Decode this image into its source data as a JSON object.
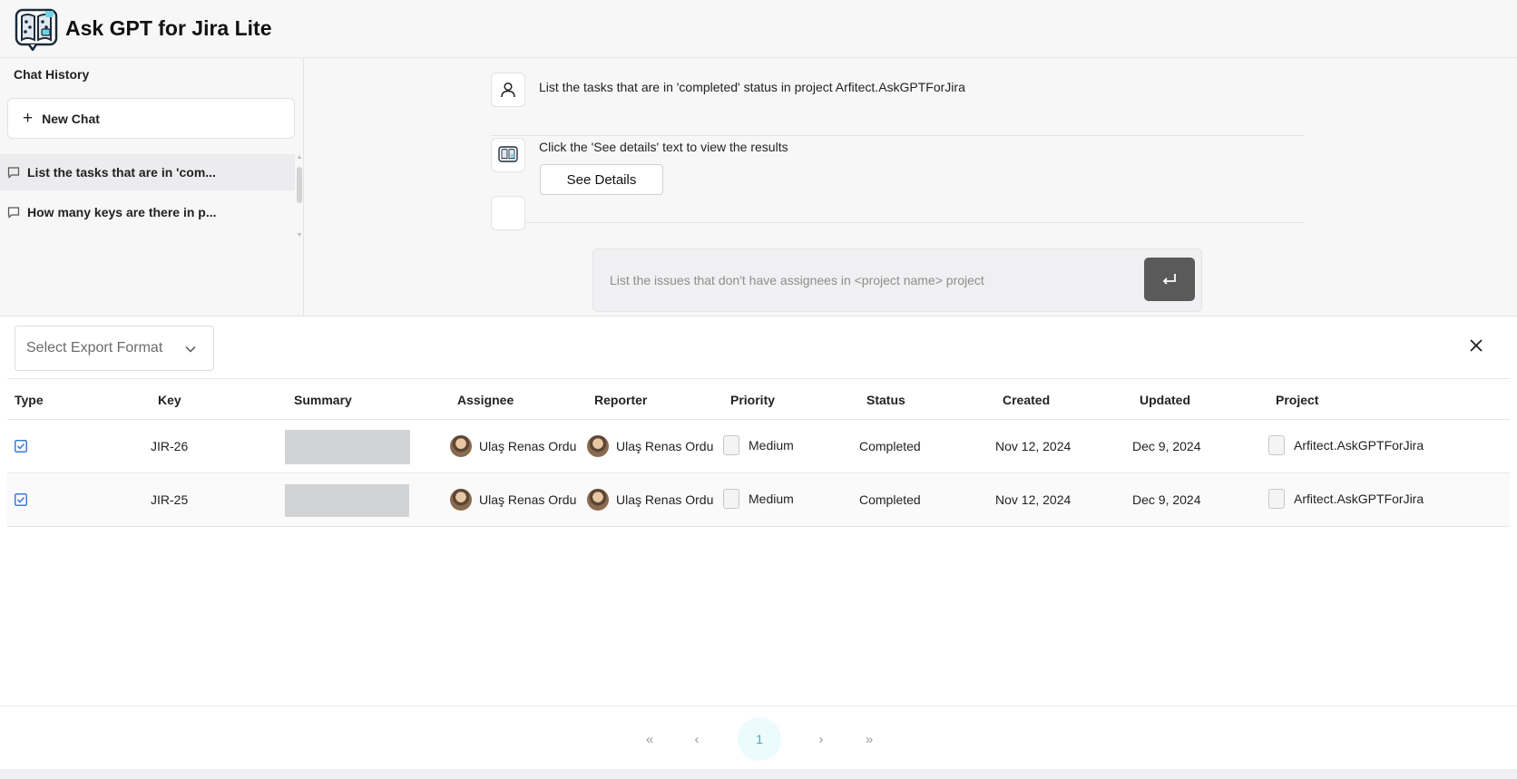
{
  "app": {
    "title": "Ask GPT for Jira Lite"
  },
  "sidebar": {
    "heading": "Chat History",
    "new_chat_label": "New Chat",
    "items": [
      {
        "label": "List the tasks that are in 'com...",
        "active": true
      },
      {
        "label": "How many keys are there in p...",
        "active": false
      }
    ]
  },
  "chat": {
    "user_message": "List the tasks that are in 'completed' status in project Arfitect.AskGPTForJira",
    "bot_message": "Click the 'See details' text to view the results",
    "see_details_label": "See Details",
    "input_placeholder": "List the issues that don't have assignees in <project name> project"
  },
  "panel": {
    "export_placeholder": "Select Export Format",
    "columns": [
      "Type",
      "Key",
      "Summary",
      "Assignee",
      "Reporter",
      "Priority",
      "Status",
      "Created",
      "Updated",
      "Project"
    ],
    "rows": [
      {
        "key": "JIR-26",
        "assignee": "Ulaş Renas Ordu",
        "reporter": "Ulaş Renas Ordu",
        "priority": "Medium",
        "status": "Completed",
        "created": "Nov 12, 2024",
        "updated": "Dec 9, 2024",
        "project": "Arfitect.AskGPTForJira"
      },
      {
        "key": "JIR-25",
        "assignee": "Ulaş Renas Ordu",
        "reporter": "Ulaş Renas Ordu",
        "priority": "Medium",
        "status": "Completed",
        "created": "Nov 12, 2024",
        "updated": "Dec 9, 2024",
        "project": "Arfitect.AskGPTForJira"
      }
    ]
  },
  "pagination": {
    "first": "«",
    "prev": "‹",
    "current": "1",
    "next": "›",
    "last": "»"
  },
  "colors": {
    "accent": "#4aa6b7",
    "send_button": "#5a5a5a",
    "checkbox": "#3b7bd8"
  },
  "icons": {
    "logo": "brain-book-icon",
    "new_chat": "plus-icon",
    "history": "message-icon",
    "user": "user-icon",
    "bot": "bot-icon",
    "send": "enter-icon",
    "export": "chevron-down-icon",
    "close": "close-icon"
  }
}
